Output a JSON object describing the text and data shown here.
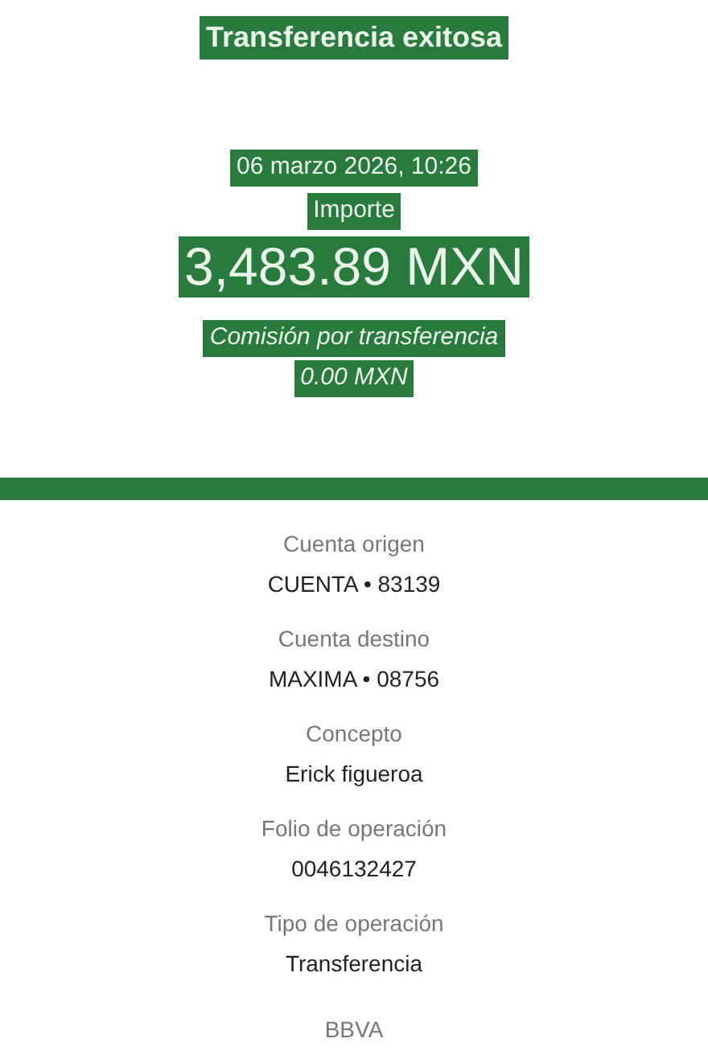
{
  "header": {
    "title": "Transferencia exitosa",
    "date": "06 marzo 2026, 10:26",
    "amount_label": "Importe",
    "amount": "3,483.89 MXN",
    "fee_label": "Comisión por transferencia",
    "fee": "0.00 MXN"
  },
  "details": [
    {
      "label": "Cuenta origen",
      "value": "CUENTA • 83139"
    },
    {
      "label": "Cuenta destino",
      "value": "MAXIMA • 08756"
    },
    {
      "label": "Concepto",
      "value": "Erick figueroa"
    },
    {
      "label": "Folio de operación",
      "value": "0046132427"
    },
    {
      "label": "Tipo de operación",
      "value": "Transferencia"
    }
  ],
  "footer": "BBVA"
}
